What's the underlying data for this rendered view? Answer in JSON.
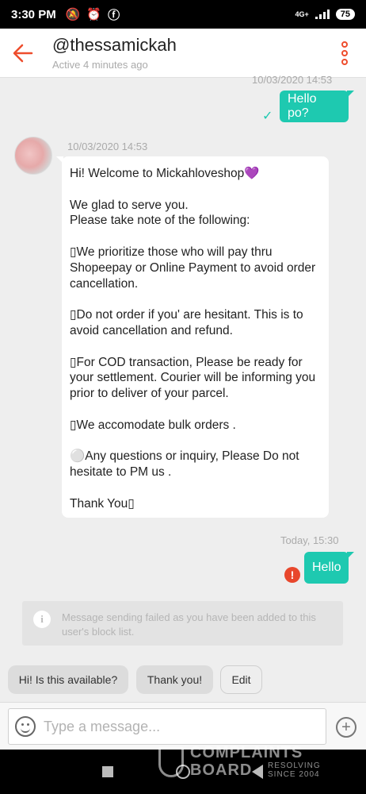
{
  "statusbar": {
    "time": "3:30 PM",
    "network": "4G+",
    "battery": "75"
  },
  "header": {
    "name": "@thessamickah",
    "status": "Active 4 minutes ago"
  },
  "messages": {
    "ts1": "10/03/2020 14:53",
    "out1": "Hello po?",
    "ts2": "10/03/2020 14:53",
    "in1": [
      "Hi! Welcome to Mickahloveshop💜",
      "We glad to serve you.\nPlease take note of the following:",
      "▯We prioritize those who will pay thru Shopeepay or Online Payment to avoid order cancellation.",
      "▯Do not order if you' are hesitant. This is to avoid cancellation and refund.",
      "▯For COD transaction, Please be ready for your settlement. Courier will be informing you prior to deliver of your parcel.",
      "▯We accomodate bulk orders .",
      "⚪Any questions or inquiry, Please Do not hesitate to PM us .",
      "Thank You▯"
    ],
    "ts3": "Today, 15:30",
    "out2": "Hello"
  },
  "notice": "Message sending failed as you have been added to this user's block list.",
  "quick_replies": [
    "Hi! Is this available?",
    "Thank you!",
    "Edit"
  ],
  "input": {
    "placeholder": "Type a message..."
  },
  "watermark": {
    "line1": "COMPLAINTS",
    "line2": "BOARD",
    "tagline1": "RESOLVING",
    "tagline2": "SINCE 2004"
  }
}
